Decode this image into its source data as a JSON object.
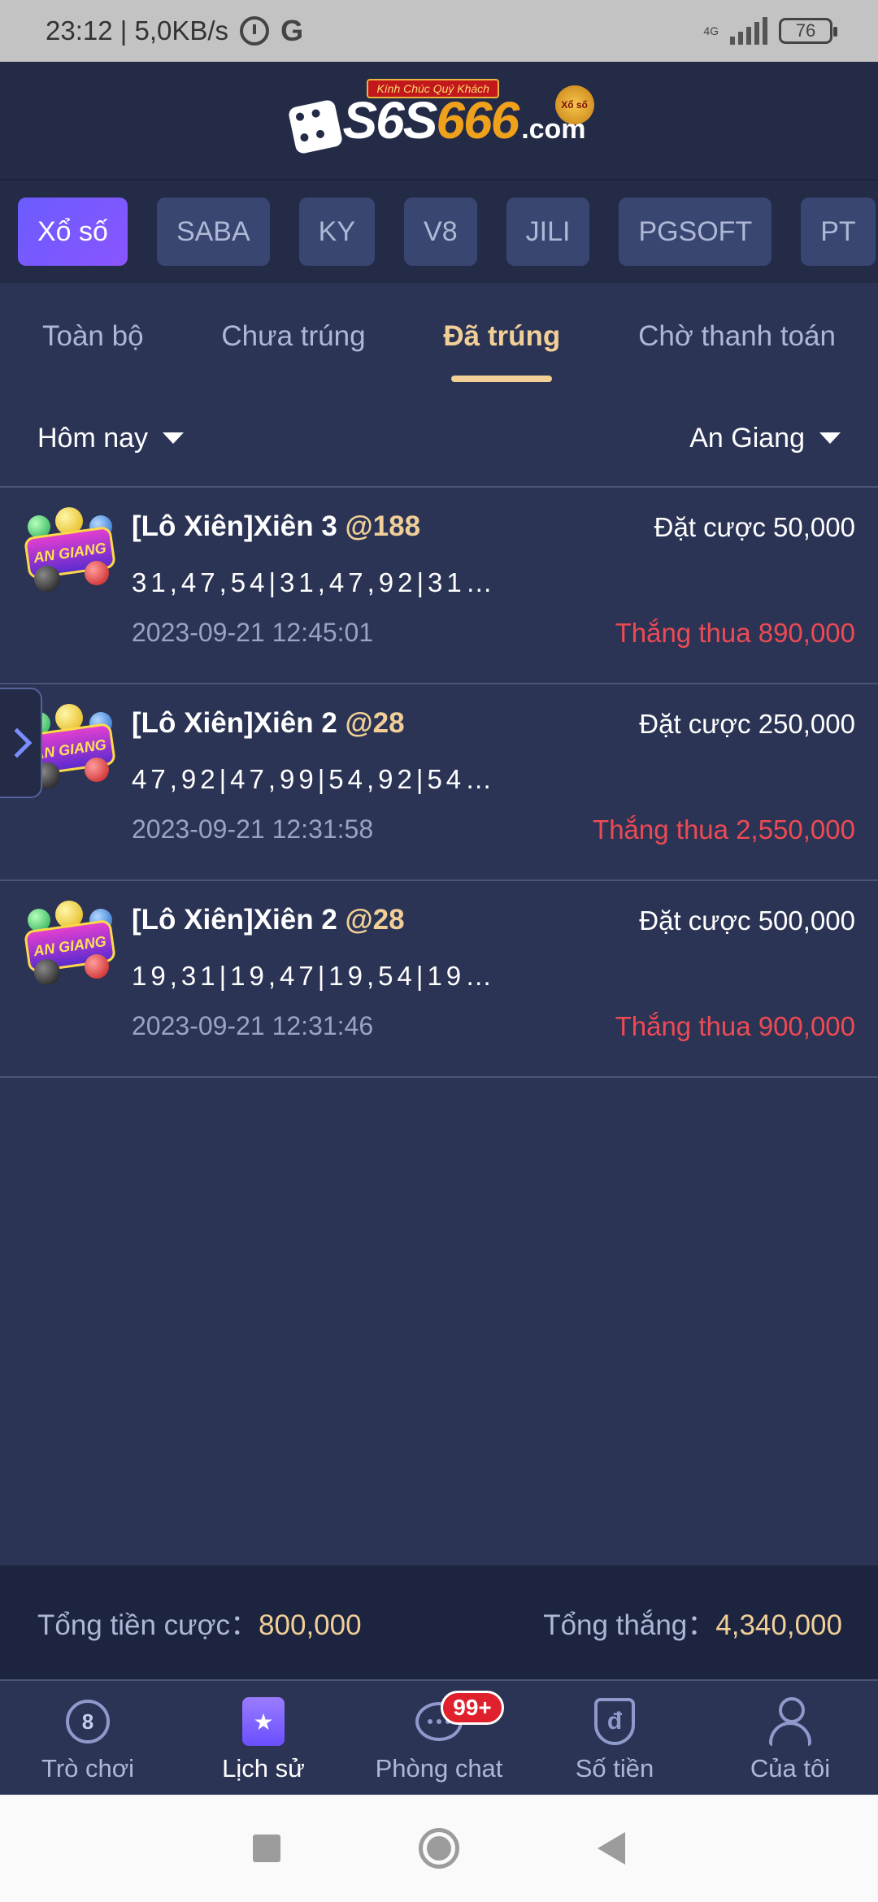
{
  "status_bar": {
    "time_speed": "23:12 | 5,0KB/s",
    "network": "4G",
    "battery": "76"
  },
  "header": {
    "logo_text": "S6S666",
    "logo_text_main": "S6S",
    "logo_text_highlight": "666",
    "logo_domain": ".com",
    "logo_tagline": "Kính Chúc Quý Khách",
    "logo_coin": "Xổ số"
  },
  "provider_tabs": [
    {
      "label": "Xổ số",
      "active": true
    },
    {
      "label": "SABA",
      "active": false
    },
    {
      "label": "KY",
      "active": false
    },
    {
      "label": "V8",
      "active": false
    },
    {
      "label": "JILI",
      "active": false
    },
    {
      "label": "PGSOFT",
      "active": false
    },
    {
      "label": "PT",
      "active": false
    }
  ],
  "status_tabs": [
    {
      "label": "Toàn bộ",
      "active": false
    },
    {
      "label": "Chưa trúng",
      "active": false
    },
    {
      "label": "Đã trúng",
      "active": true
    },
    {
      "label": "Chờ thanh toán",
      "active": false
    }
  ],
  "filters": {
    "date": "Hôm nay",
    "region": "An Giang"
  },
  "bets": [
    {
      "thumb_label": "AN GIANG",
      "title": "[Lô Xiên]Xiên 3",
      "odds": "@188",
      "stake": "Đặt cược 50,000",
      "numbers": "31,47,54|31,47,92|31…",
      "time": "2023-09-21 12:45:01",
      "result": "Thắng thua 890,000"
    },
    {
      "thumb_label": "AN GIANG",
      "title": "[Lô Xiên]Xiên 2",
      "odds": "@28",
      "stake": "Đặt cược 250,000",
      "numbers": "47,92|47,99|54,92|54…",
      "time": "2023-09-21 12:31:58",
      "result": "Thắng thua 2,550,000"
    },
    {
      "thumb_label": "AN GIANG",
      "title": "[Lô Xiên]Xiên 2",
      "odds": "@28",
      "stake": "Đặt cược 500,000",
      "numbers": "19,31|19,47|19,54|19…",
      "time": "2023-09-21 12:31:46",
      "result": "Thắng thua 900,000"
    }
  ],
  "totals": {
    "bet_label": "Tổng tiền cược：",
    "bet_value": "800,000",
    "win_label": "Tổng thắng：",
    "win_value": "4,340,000"
  },
  "bottom_nav": [
    {
      "label": "Trò chơi",
      "icon": "dragon-icon",
      "active": false
    },
    {
      "label": "Lịch sử",
      "icon": "history-icon",
      "active": true
    },
    {
      "label": "Phòng chat",
      "icon": "chat-icon",
      "active": false,
      "badge": "99+"
    },
    {
      "label": "Số tiền",
      "icon": "money-shield-icon",
      "active": false,
      "symbol": "đ"
    },
    {
      "label": "Của tôi",
      "icon": "user-icon",
      "active": false
    }
  ],
  "colors": {
    "background": "#2b3455",
    "header": "#232b47",
    "accent_gold": "#f1cf97",
    "active_purple": "#6a5cff",
    "loss_red": "#ee4a54"
  }
}
